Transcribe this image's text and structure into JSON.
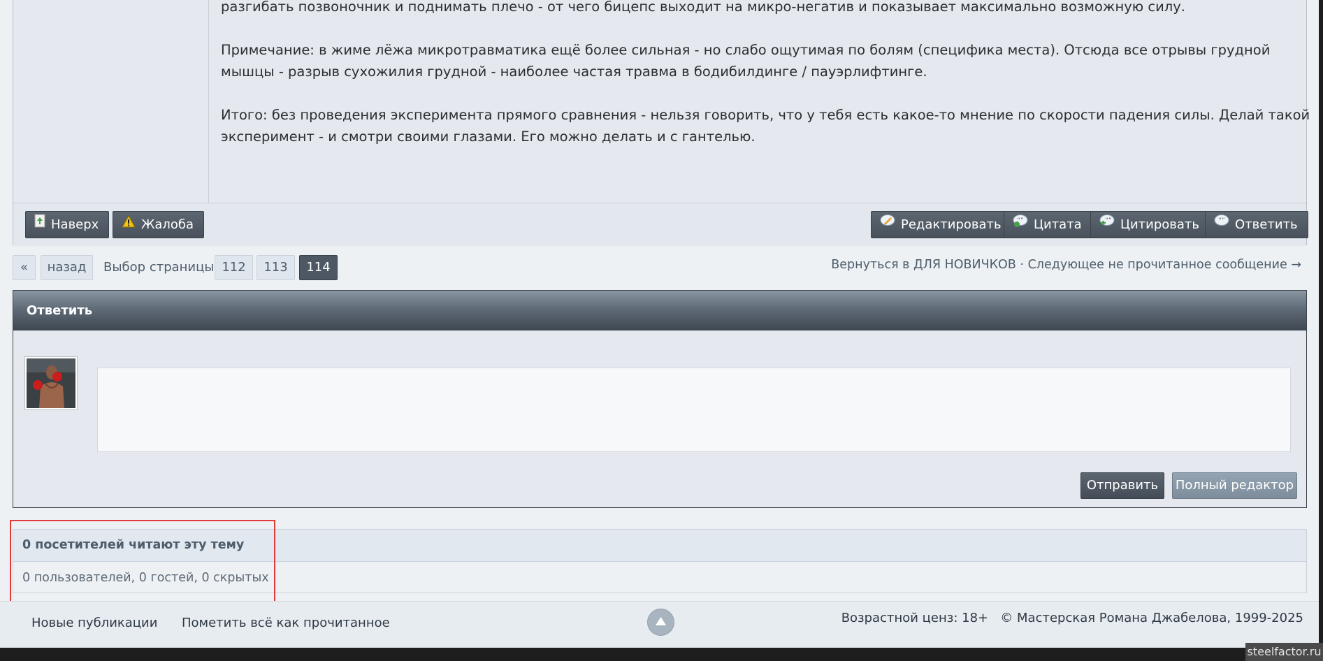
{
  "post": {
    "paragraphs": [
      "разгибать позвоночник и поднимать плечо - от чего бицепс выходит на микро-негатив и показывает максимально возможную силу.",
      "Примечание: в жиме лёжа микротравматика ещё более сильная - но слабо ощутимая по болям (специфика места). Отсюда все отрывы грудной мышцы - разрыв сухожилия грудной - наиболее частая травма в бодибилдинге / пауэрлифтинге.",
      "Итого: без проведения эксперимента прямого сравнения - нельзя говорить, что у тебя есть какое-то мнение по скорости падения силы. Делай такой эксперимент - и смотри своими глазами. Его можно делать и с гантелью."
    ],
    "actions": {
      "top": "Наверх",
      "report": "Жалоба",
      "edit": "Редактировать",
      "quote": "Цитата",
      "cite": "Цитировать",
      "reply": "Ответить"
    }
  },
  "pagination": {
    "first": "«",
    "prev": "назад",
    "label": "Выбор страницы",
    "pages": [
      "112",
      "113",
      "114"
    ],
    "current": "114"
  },
  "topic_nav": {
    "back": "Вернуться в ДЛЯ НОВИЧКОВ",
    "separator": "·",
    "next_unread": "Следующее не прочитанное сообщение",
    "arrow": "→"
  },
  "reply_block": {
    "title": "Ответить",
    "send_label": "Отправить",
    "full_editor_label": "Полный редактор"
  },
  "visitors": {
    "title": "0 посетителей читают эту тему",
    "summary": "0 пользователей, 0 гостей, 0 скрытых"
  },
  "footer": {
    "new_posts": "Новые публикации",
    "mark_read": "Пометить всё как прочитанное",
    "age_rating": "Возрастной ценз: 18+",
    "copyright": "© Мастерская Романа Джабелова, 1999-2025"
  },
  "watermark": "steelfactor.ru",
  "colors": {
    "highlight": "#e23a3a",
    "active_page": "#4d5864",
    "header_dark": "#3f4852"
  }
}
